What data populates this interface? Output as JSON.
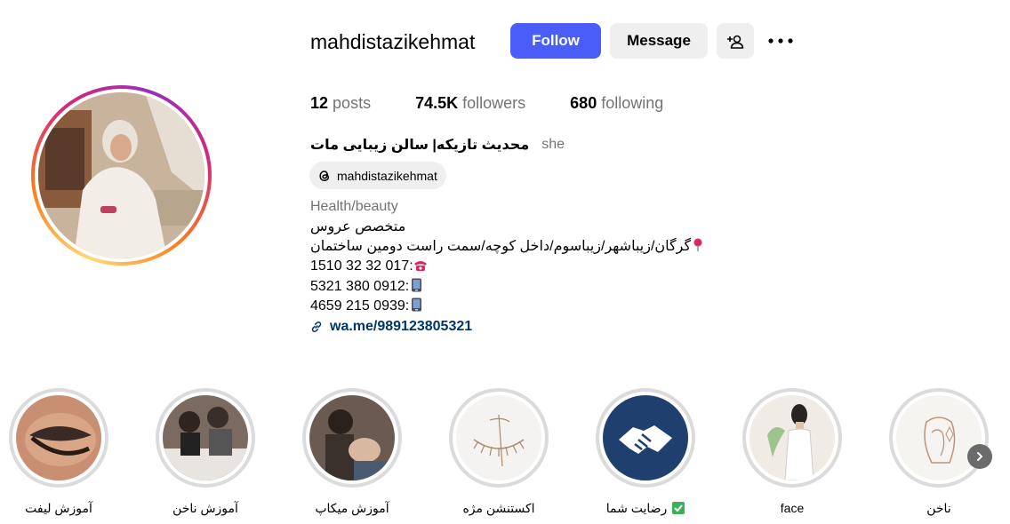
{
  "profile": {
    "username": "mahdistazikehmat",
    "follow_label": "Follow",
    "message_label": "Message",
    "stats": [
      {
        "count": "12",
        "label": "posts"
      },
      {
        "count": "74.5K",
        "label": "followers"
      },
      {
        "count": "680",
        "label": "following"
      }
    ],
    "full_name": "محدیث تازیکه| سالن زیبایی مات",
    "pronouns": "she",
    "threads_handle": "mahdistazikehmat",
    "category": "Health/beauty",
    "bio_lines": [
      "متخصص عروس",
      "گرگان/زیباشهر/زیباسوم/داخل کوچه/سمت راست دومین ساختمان",
      "1510 32 32 017:",
      "5321 380 0912:",
      "4659 215 0939:"
    ],
    "link": "wa.me/989123805321"
  },
  "highlights": [
    {
      "label": "آموزش لیفت"
    },
    {
      "label": "آموزش ناخن"
    },
    {
      "label": "آموزش میکاپ"
    },
    {
      "label": "اکستنشن مژه"
    },
    {
      "label": "رضایت شما"
    },
    {
      "label": "face"
    },
    {
      "label": "ناخن"
    }
  ],
  "icons": {
    "add_user": "add-user-icon",
    "more": "more-options-icon",
    "threads": "threads-icon",
    "link": "link-icon",
    "location": "pin-icon",
    "phone": "telephone-icon",
    "mobile": "mobile-phone-icon",
    "check": "check-mark-icon",
    "next": "chevron-right-icon"
  },
  "colors": {
    "accent": "#4a5df9",
    "link": "#00376b",
    "muted": "#737373",
    "button_bg": "#efefef"
  }
}
